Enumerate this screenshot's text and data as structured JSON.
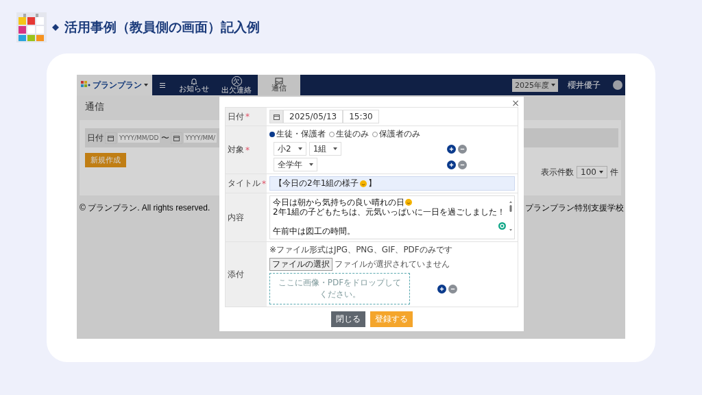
{
  "slide": {
    "title": "活用事例（教員側の画面）記入例"
  },
  "app": {
    "brand": "プランプラン",
    "nav": [
      {
        "label": "お知らせ",
        "kind": "bell",
        "selected": false
      },
      {
        "label": "出欠連絡",
        "kind": "badge",
        "glyph": "欠",
        "selected": false
      },
      {
        "label": "通信",
        "kind": "tray",
        "selected": true
      }
    ],
    "year": "2025年度",
    "user": "櫻井優子",
    "page_title": "通信",
    "filter": {
      "label": "日付",
      "from": "YYYY/MM/DD",
      "sep": "〜",
      "to": "YYYY/MM/"
    },
    "new_button": "新規作成",
    "per_page": {
      "label": "表示件数",
      "value": "100",
      "unit": "件"
    },
    "footer": {
      "copyright": "© プランプラン. All rights reserved.",
      "school": "プランプラン特別支援学校"
    }
  },
  "modal": {
    "close": "×",
    "date": {
      "label": "日付",
      "required_mark": "*",
      "date": "2025/05/13",
      "time": "15:30"
    },
    "target": {
      "label": "対象",
      "required_mark": "*",
      "radios": [
        {
          "label": "生徒・保護者",
          "selected": true
        },
        {
          "label": "生徒のみ",
          "selected": false
        },
        {
          "label": "保護者のみ",
          "selected": false
        }
      ],
      "rows": [
        [
          "小2",
          "1組"
        ],
        [
          "全学年"
        ]
      ]
    },
    "title": {
      "label": "タイトル",
      "required_mark": "*",
      "text_start": "【今日の2年1組の様子",
      "text_end": "】"
    },
    "content": {
      "label": "内容",
      "lines": [
        {
          "kind": "text",
          "text": "今日は朝から気持ちの良い晴れの日",
          "emoji": true
        },
        {
          "kind": "text",
          "text": "2年1組の子どもたちは、元気いっぱいに一日を過ごしました！"
        },
        {
          "kind": "blank"
        },
        {
          "kind": "text",
          "text": "午前中は図工の時間。"
        }
      ]
    },
    "attach": {
      "label": "添付",
      "note": "※ファイル形式はJPG、PNG、GIF、PDFのみです",
      "file_button": "ファイルの選択",
      "file_status": "ファイルが選択されていません",
      "drop": "ここに画像・PDFをドロップしてください。"
    },
    "buttons": [
      {
        "label": "閉じる",
        "kind": "secondary"
      },
      {
        "label": "登録する",
        "kind": "primary"
      }
    ]
  }
}
